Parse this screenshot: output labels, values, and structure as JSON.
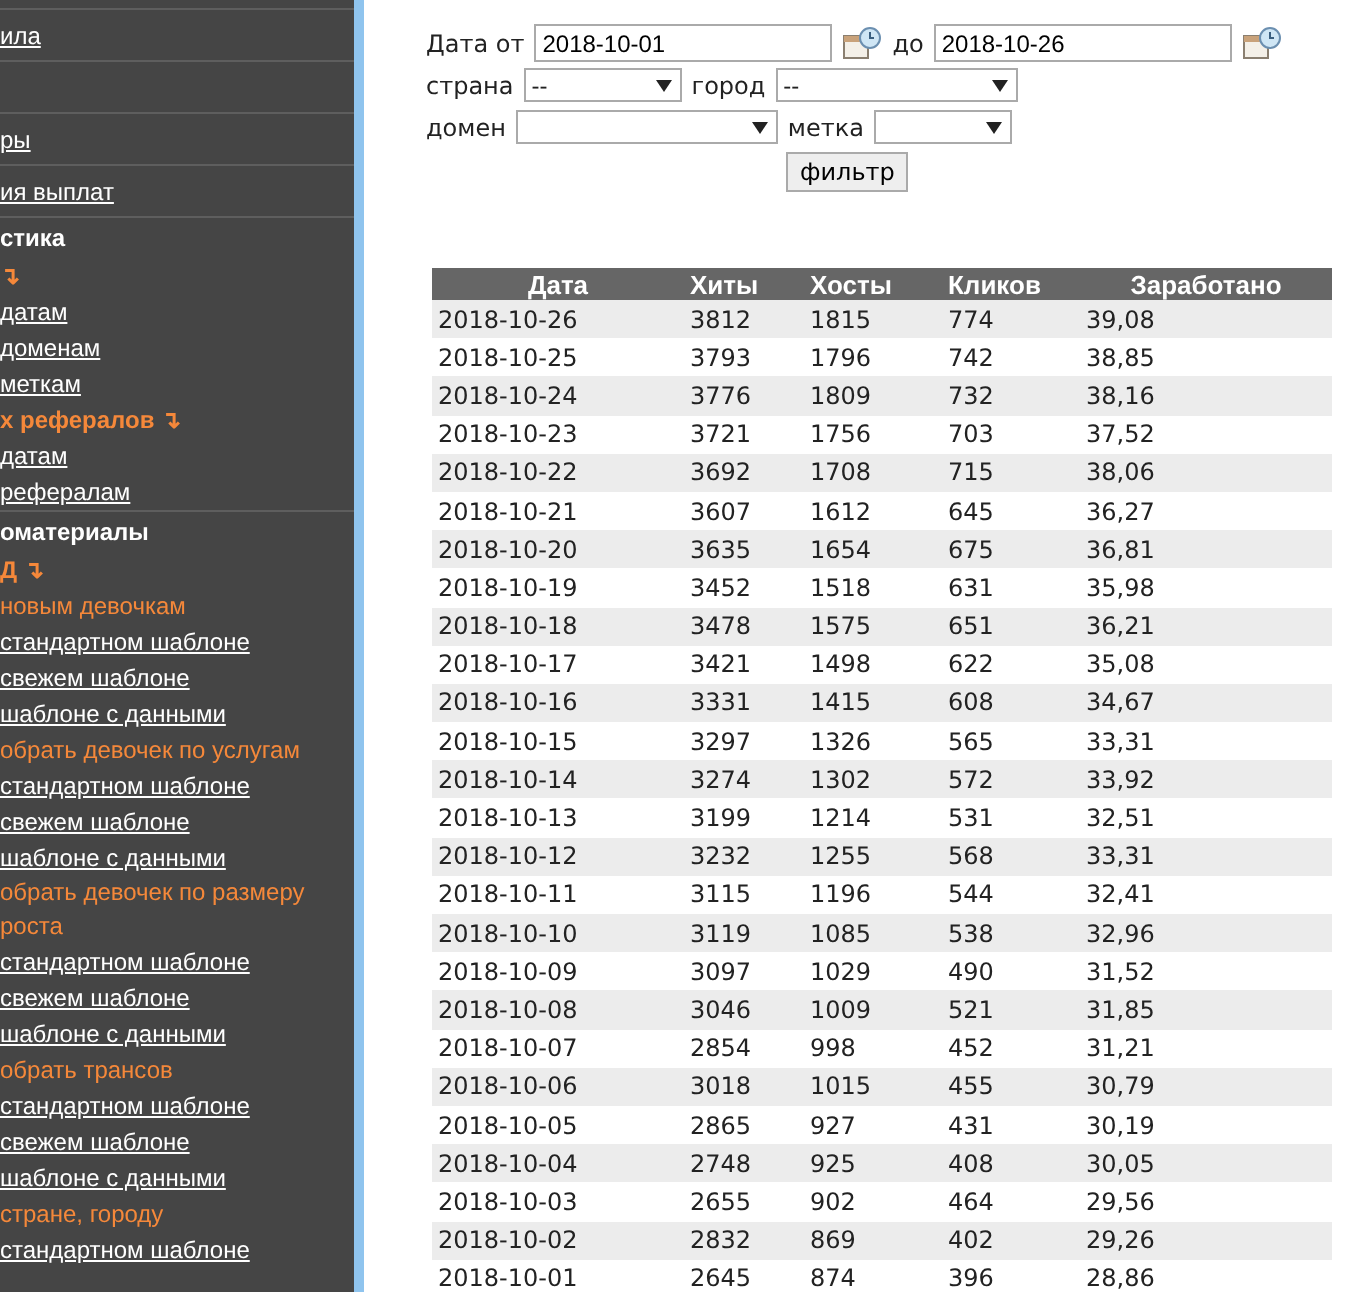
{
  "sidebar": {
    "items": [
      {
        "kind": "link",
        "text": "ила",
        "divider": true
      },
      {
        "kind": "blank",
        "divider": true
      },
      {
        "kind": "link",
        "text": "ры",
        "divider": true
      },
      {
        "kind": "link",
        "text": "ия выплат",
        "divider": true
      },
      {
        "kind": "heading",
        "text": "стика"
      },
      {
        "kind": "section",
        "text": "↴"
      },
      {
        "kind": "link",
        "text": "датам"
      },
      {
        "kind": "link",
        "text": "доменам"
      },
      {
        "kind": "link",
        "text": "меткам"
      },
      {
        "kind": "section",
        "text": "х рефералов ↴"
      },
      {
        "kind": "link",
        "text": "датам"
      },
      {
        "kind": "link",
        "text": "рефералам",
        "divider": true
      },
      {
        "kind": "heading",
        "text": "оматериалы"
      },
      {
        "kind": "section",
        "text": "Д ↴"
      },
      {
        "kind": "label",
        "text": "новым девочкам"
      },
      {
        "kind": "link",
        "text": "стандартном шаблоне"
      },
      {
        "kind": "link",
        "text": "свежем шаблоне"
      },
      {
        "kind": "link",
        "text": "шаблоне с данными"
      },
      {
        "kind": "label",
        "text": "обрать девочек по услугам"
      },
      {
        "kind": "link",
        "text": "стандартном шаблоне"
      },
      {
        "kind": "link",
        "text": "свежем шаблоне"
      },
      {
        "kind": "link",
        "text": "шаблоне с данными"
      },
      {
        "kind": "label",
        "text": "обрать девочек по размеру роста"
      },
      {
        "kind": "link",
        "text": "стандартном шаблоне"
      },
      {
        "kind": "link",
        "text": "свежем шаблоне"
      },
      {
        "kind": "link",
        "text": "шаблоне с данными"
      },
      {
        "kind": "label",
        "text": "обрать трансов"
      },
      {
        "kind": "link",
        "text": "стандартном шаблоне"
      },
      {
        "kind": "link",
        "text": "свежем шаблоне"
      },
      {
        "kind": "link",
        "text": "шаблоне с данными"
      },
      {
        "kind": "label",
        "text": "стране, городу"
      },
      {
        "kind": "link",
        "text": "стандартном шаблоне"
      }
    ]
  },
  "filter": {
    "date_from_label": "Дата от",
    "date_from": "2018-10-01",
    "date_to_label": "до",
    "date_to": "2018-10-26",
    "country_label": "страна",
    "country": "--",
    "city_label": "город",
    "city": "--",
    "domain_label": "домен",
    "tag_label": "метка",
    "button": "фильтр"
  },
  "table": {
    "columns": [
      "Дата",
      "Хиты",
      "Хосты",
      "Кликов",
      "Заработано"
    ],
    "rows": [
      [
        "2018-10-26",
        "3812",
        "1815",
        "774",
        "39,08"
      ],
      [
        "2018-10-25",
        "3793",
        "1796",
        "742",
        "38,85"
      ],
      [
        "2018-10-24",
        "3776",
        "1809",
        "732",
        "38,16"
      ],
      [
        "2018-10-23",
        "3721",
        "1756",
        "703",
        "37,52"
      ],
      [
        "2018-10-22",
        "3692",
        "1708",
        "715",
        "38,06"
      ],
      [
        "2018-10-21",
        "3607",
        "1612",
        "645",
        "36,27"
      ],
      [
        "2018-10-20",
        "3635",
        "1654",
        "675",
        "36,81"
      ],
      [
        "2018-10-19",
        "3452",
        "1518",
        "631",
        "35,98"
      ],
      [
        "2018-10-18",
        "3478",
        "1575",
        "651",
        "36,21"
      ],
      [
        "2018-10-17",
        "3421",
        "1498",
        "622",
        "35,08"
      ],
      [
        "2018-10-16",
        "3331",
        "1415",
        "608",
        "34,67"
      ],
      [
        "2018-10-15",
        "3297",
        "1326",
        "565",
        "33,31"
      ],
      [
        "2018-10-14",
        "3274",
        "1302",
        "572",
        "33,92"
      ],
      [
        "2018-10-13",
        "3199",
        "1214",
        "531",
        "32,51"
      ],
      [
        "2018-10-12",
        "3232",
        "1255",
        "568",
        "33,31"
      ],
      [
        "2018-10-11",
        "3115",
        "1196",
        "544",
        "32,41"
      ],
      [
        "2018-10-10",
        "3119",
        "1085",
        "538",
        "32,96"
      ],
      [
        "2018-10-09",
        "3097",
        "1029",
        "490",
        "31,52"
      ],
      [
        "2018-10-08",
        "3046",
        "1009",
        "521",
        "31,85"
      ],
      [
        "2018-10-07",
        "2854",
        "998",
        "452",
        "31,21"
      ],
      [
        "2018-10-06",
        "3018",
        "1015",
        "455",
        "30,79"
      ],
      [
        "2018-10-05",
        "2865",
        "927",
        "431",
        "30,19"
      ],
      [
        "2018-10-04",
        "2748",
        "925",
        "408",
        "30,05"
      ],
      [
        "2018-10-03",
        "2655",
        "902",
        "464",
        "29,56"
      ],
      [
        "2018-10-02",
        "2832",
        "869",
        "402",
        "29,26"
      ],
      [
        "2018-10-01",
        "2645",
        "874",
        "396",
        "28,86"
      ]
    ]
  }
}
